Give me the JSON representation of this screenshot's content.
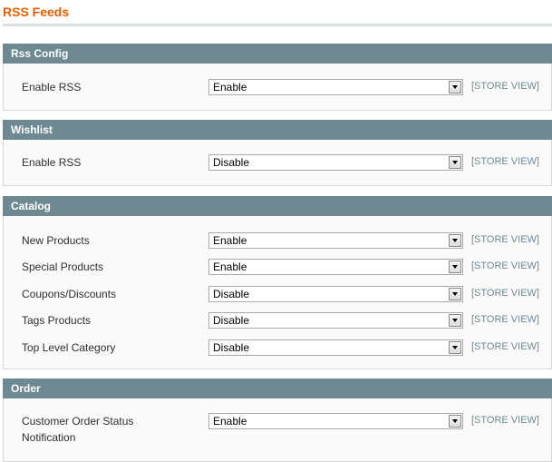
{
  "page": {
    "title": "RSS Feeds"
  },
  "sections": [
    {
      "title": "Rss Config",
      "rows": [
        {
          "label": "Enable RSS",
          "value": "Enable",
          "scope": "[STORE VIEW]"
        }
      ]
    },
    {
      "title": "Wishlist",
      "rows": [
        {
          "label": "Enable RSS",
          "value": "Disable",
          "scope": "[STORE VIEW]"
        }
      ]
    },
    {
      "title": "Catalog",
      "rows": [
        {
          "label": "New Products",
          "value": "Enable",
          "scope": "[STORE VIEW]"
        },
        {
          "label": "Special Products",
          "value": "Enable",
          "scope": "[STORE VIEW]"
        },
        {
          "label": "Coupons/Discounts",
          "value": "Disable",
          "scope": "[STORE VIEW]"
        },
        {
          "label": "Tags Products",
          "value": "Disable",
          "scope": "[STORE VIEW]"
        },
        {
          "label": "Top Level Category",
          "value": "Disable",
          "scope": "[STORE VIEW]"
        }
      ]
    },
    {
      "title": "Order",
      "rows": [
        {
          "label": "Customer Order Status Notification",
          "value": "Enable",
          "scope": "[STORE VIEW]"
        }
      ]
    }
  ]
}
